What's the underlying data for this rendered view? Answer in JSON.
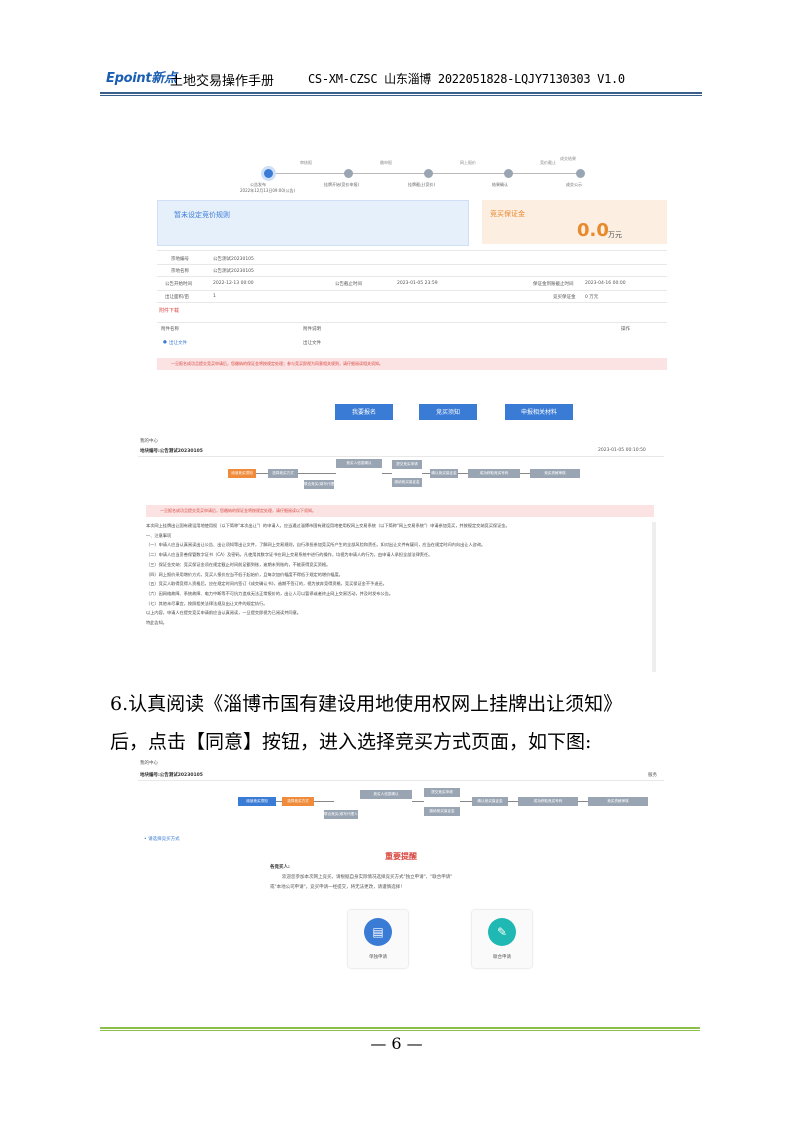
{
  "header": {
    "logo_text": "Epoint新点",
    "title": "土地交易操作手册",
    "code": "CS-XM-CZSC 山东淄博 2022051828-LQJY7130303  V1.0"
  },
  "shot1": {
    "steps": [
      {
        "label": "审核报",
        "sub": "公告发布"
      },
      {
        "label": "缴申报",
        "sub": "挂牌开始(竞价申报)"
      },
      {
        "label": "网上报价",
        "sub": "挂牌截止(竞价)"
      },
      {
        "label": "竞价截止",
        "sub": "结果确认"
      },
      {
        "label": "成交结果",
        "sub": "成交公示"
      }
    ],
    "step_date": "2022年12月13日09:00(公告)",
    "rule_title": "暂未设定竞价规则",
    "deposit_title": "竞买保证金",
    "deposit_value": "0.0",
    "deposit_unit": "万元",
    "rows": [
      {
        "k": "宗地编号",
        "v": "公告测试20230105"
      },
      {
        "k": "宗地名称",
        "v": "公告测试20230105"
      },
      {
        "k": "公告开始时间",
        "v": "2022-12-13 00:00",
        "k2": "公告截止时间",
        "v2": "2023-01-05 23:59",
        "k3": "保证金到账截止时间",
        "v3": "2023-04-16 00:00"
      },
      {
        "k": "出让面积/亩",
        "v": "1",
        "k2": "",
        "v2": "",
        "k3": "竞买保证金",
        "v3": "0   万元"
      }
    ],
    "attach_title": "附件下载",
    "attach_head1": "附件名称",
    "attach_head2": "附件说明",
    "attach_head3": "操作",
    "attach_file": "出让文件",
    "attach_desc": "出让文件",
    "warn": "一旦报名成功且提交竞买申请后，您缴纳的保证金将按规定处理；参与竞买即视为同意相关规则，请仔细阅读相关须知。",
    "buttons": [
      "我要报名",
      "竞买须知",
      "申报相关材料"
    ]
  },
  "shot2": {
    "crumb": "我的中心",
    "name": "地块编号:公告测试20230105",
    "time": "2023-01-05 00:10:50",
    "flow": [
      "阅读竞买须知",
      "选择竞买方式",
      "联合竞买(填写代理人)",
      "竞买人信息确认",
      "提交竞买申请",
      "缴纳竞买保证金",
      "确认竞买保证金",
      "成功获取竞买号码",
      "竞买资格审核",
      "缴纳保证金确认"
    ],
    "warn": "一旦报名成功且提交竞买申请后，您缴纳的保证金将按规定处理，请仔细阅读以下须知。",
    "notice": [
      "本次网上挂牌出让国有建设用地使用权（以下简称\"本次出让\"）的申请人，应当通过淄博市国有建设用地使用权网上交易系统（以下简称\"网上交易系统\"）申请参加竞买，并按规定交纳竞买保证金。",
      "一、注意事项",
      "（一）申请人应当认真阅读出让公告、出让须知等出让文件，了解网上交易规则，自行承担参加竞买所产生的全部风险和责任。如对出让文件有疑问，应当在规定时间内向出让人咨询。",
      "（二）申请人应当妥善保管数字证书（CA）及密码，凡使用其数字证书在网上交易系统中进行的操作，均视为申请人的行为，由申请人承担全部法律责任。",
      "（三）保证金交纳：竞买保证金须在规定截止时间前足额到账，逾期未到账的，不能获得竞买资格。",
      "（四）网上报价采用增价方式，竞买人报价应当不低于起始价，且每次加价幅度不得低于规定的增价幅度。",
      "（五）竞买人取得竞得人资格后，应在规定时间内签订《成交确认书》，逾期不签订的，视为放弃竞得资格，竞买保证金不予退还。",
      "（六）因网络故障、系统故障、电力中断等不可抗力造成无法正常报价的，出让人可以暂停或者终止网上交易活动，并及时发布公告。",
      "（七）其他未尽事宜，按照相关法律法规及出让文件的规定执行。",
      "以上内容，申请人在提交竞买申请前应当认真阅读，一旦提交即视为已阅读并同意。",
      "特此告知。"
    ]
  },
  "body_text": {
    "line1": "6.认真阅读《淄博市国有建设用地使用权网上挂牌出让须知》",
    "line2": "后，点击【同意】按钮，进入选择竞买方式页面，如下图:"
  },
  "shot3": {
    "crumb": "我的中心",
    "name": "地块编号:公告测试20230105",
    "right": "服务",
    "flow": [
      "阅读竞买须知",
      "选择竞买方式",
      "联合竞买(填写代理人)",
      "竞买人信息确认",
      "提交竞买申请",
      "缴纳竞买保证金",
      "确认竞买保证金",
      "成功获取竞买号码",
      "竞买资格审核",
      "缴纳保证金确认"
    ],
    "section": "• 请选择竞买方式",
    "title": "重要提醒",
    "greet": "各竞买人:",
    "msg1": "欢迎您参加本次网上竞买。请根据自身实际情况选择竞买方式\"独立申请\"、\"联合申请\"",
    "msg2": "或\"本地公司申请\"，竞买申请一经提交，将无法更改，请谨慎选择！",
    "choices": [
      "单独申请",
      "联合申请"
    ]
  },
  "footer": {
    "page": "— 6 —"
  }
}
